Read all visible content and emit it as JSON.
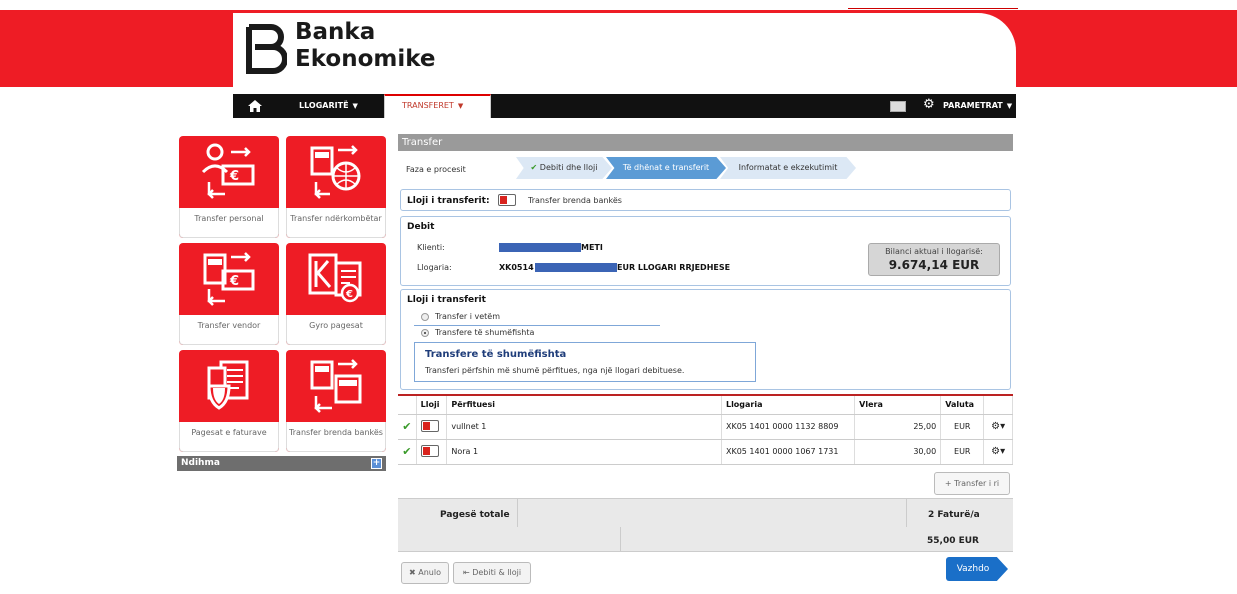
{
  "brand": {
    "line1": "Banka",
    "line2": "Ekonomike",
    "color": "#ee1c25"
  },
  "nav": {
    "home_icon": "home-icon",
    "items": [
      {
        "label": "LLOGARITË",
        "active": false
      },
      {
        "label": "TRANSFERET",
        "active": true
      }
    ],
    "mail_icon": "mail-icon",
    "settings_label": "PARAMETRAT"
  },
  "tiles": [
    {
      "label": "Transfer personal",
      "icon": "personal-transfer-icon"
    },
    {
      "label": "Transfer ndërkombëtar",
      "icon": "international-transfer-icon"
    },
    {
      "label": "Transfer vendor",
      "icon": "domestic-transfer-icon"
    },
    {
      "label": "Gyro pagesat",
      "icon": "giro-payment-icon"
    },
    {
      "label": "Pagesat e faturave",
      "icon": "bill-payment-icon"
    },
    {
      "label": "Transfer brenda bankës",
      "icon": "internal-transfer-icon"
    }
  ],
  "help": {
    "label": "Ndihma"
  },
  "panel": {
    "title": "Transfer",
    "process_label": "Faza e procesit",
    "steps": [
      "Debiti dhe lloji",
      "Të dhënat e transferit",
      "Informatat e ekzekutimit"
    ],
    "type_label": "Lloji i transferit:",
    "type_value": "Transfer brenda bankës",
    "debit": {
      "title": "Debit",
      "client_label": "Klienti:",
      "client_value": "METI",
      "account_label": "Llogaria:",
      "account_prefix": "XK0514",
      "account_suffix": "EUR LLOGARI RRJEDHESE",
      "balance_label": "Bilanci aktual i llogarisë:",
      "balance_value": "9.674,14 EUR"
    },
    "transfer_type": {
      "title": "Lloji i transferit",
      "options": [
        "Transfer i vetëm",
        "Transfere të shumëfishta"
      ],
      "selected": 1,
      "tip_title": "Transfere të shumëfishta",
      "tip_body": "Transferi përfshin më shumë përfitues, nga një llogari debituese."
    }
  },
  "table": {
    "headers": {
      "type": "Lloji",
      "beneficiary": "Përfituesi",
      "account": "Llogaria",
      "amount": "Vlera",
      "currency": "Valuta"
    },
    "rows": [
      {
        "beneficiary": "vullnet 1",
        "account": "XK05 1401 0000 1132 8809",
        "amount": "25,00",
        "currency": "EUR"
      },
      {
        "beneficiary": "Nora 1",
        "account": "XK05 1401 0000 1067 1731",
        "amount": "30,00",
        "currency": "EUR"
      }
    ],
    "new_button": "Transfer i ri"
  },
  "totals": {
    "label": "Pagesë totale",
    "count": "2 Faturë/a",
    "amount": "55,00 EUR"
  },
  "buttons": {
    "cancel": "Anulo",
    "back": "Debiti & lloji",
    "next": "Vazhdo"
  }
}
